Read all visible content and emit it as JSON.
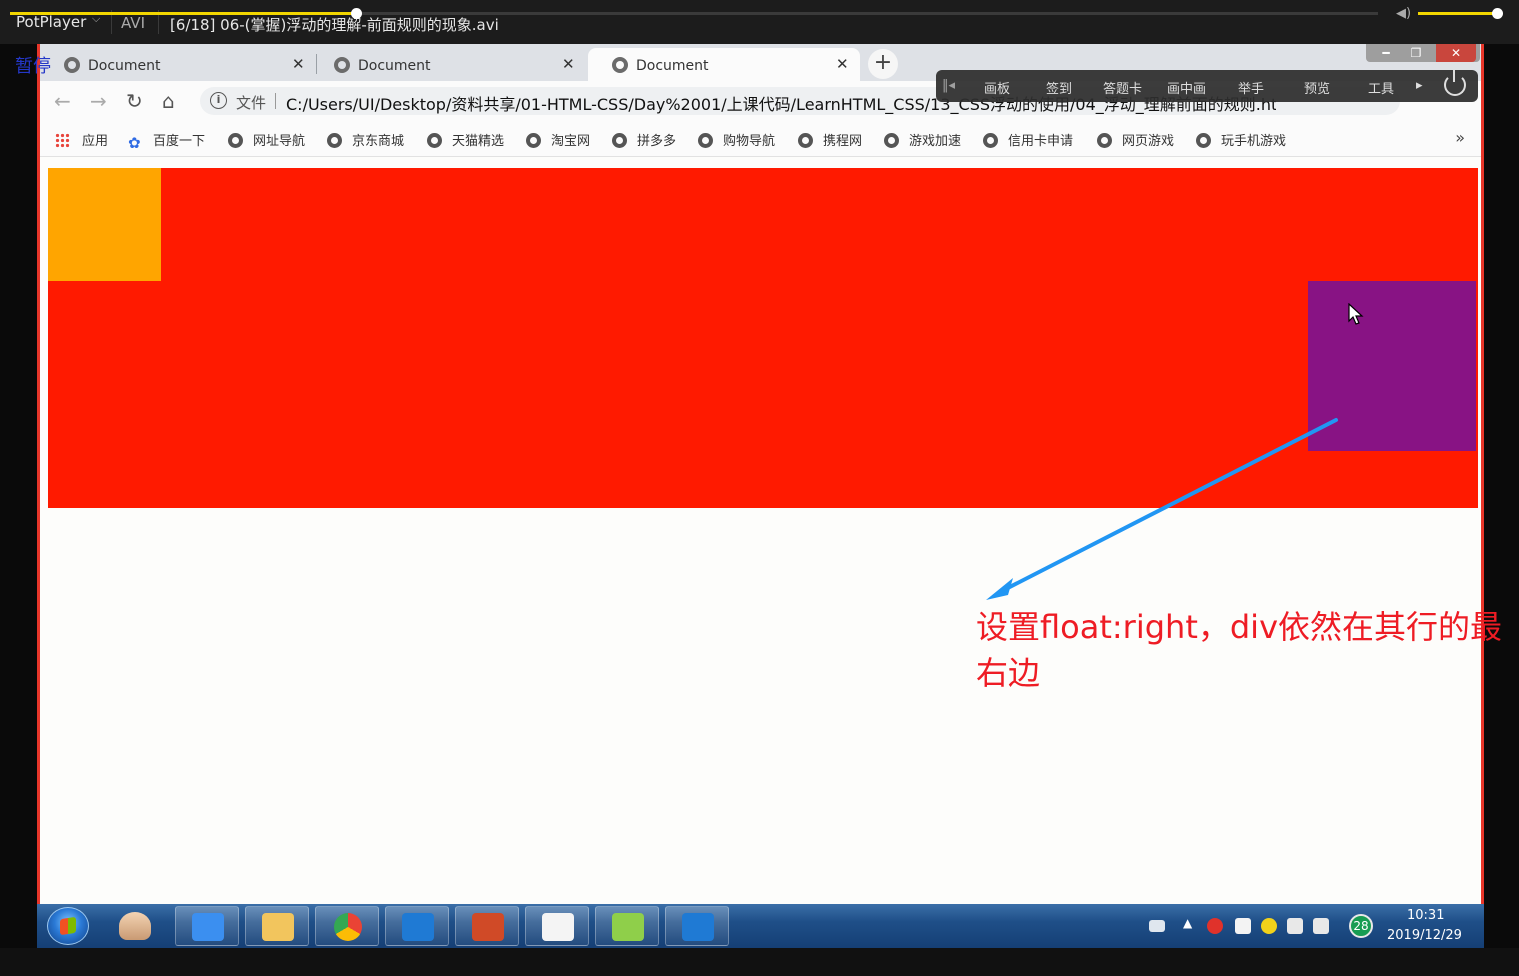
{
  "player": {
    "app_name": "PotPlayer",
    "format": "AVI",
    "file_title": "[6/18] 06-(掌握)浮动的理解-前面规则的现象.avi",
    "status_overlay": "暂停",
    "seek_progress": 0.253,
    "volume": 1.0
  },
  "browser": {
    "tabs": [
      {
        "title": "Document",
        "close": "✕"
      },
      {
        "title": "Document",
        "close": "✕"
      },
      {
        "title": "Document",
        "close": "✕"
      }
    ],
    "new_tab": "+",
    "window_buttons": {
      "minimize": "━",
      "restore": "❐",
      "close": "✕"
    },
    "address": {
      "scheme_label": "文件",
      "url": "C:/Users/UI/Desktop/资料共享/01-HTML-CSS/Day%2001/上课代码/LearnHTML_CSS/13_CSS浮动的使用/04_浮动_理解前面的规则.html"
    },
    "bookmarks": [
      "应用",
      "百度一下",
      "网址导航",
      "京东商城",
      "天猫精选",
      "淘宝网",
      "拼多多",
      "购物导航",
      "携程网",
      "游戏加速",
      "信用卡申请",
      "网页游戏",
      "玩手机游戏"
    ],
    "bookmarks_more": "»"
  },
  "page": {
    "colors": {
      "container": "#ff1a00",
      "left_box": "#ffa500",
      "right_box": "#881384"
    }
  },
  "recorder_toolbar": {
    "items": [
      "画板",
      "签到",
      "答题卡",
      "画中画",
      "举手",
      "预览",
      "工具"
    ]
  },
  "annotation": {
    "text": "设置float:right，div依然在其行的最右边",
    "color": "#ee1c24"
  },
  "taskbar": {
    "tray_badge": "28",
    "time": "10:31",
    "date": "2019/12/29"
  }
}
